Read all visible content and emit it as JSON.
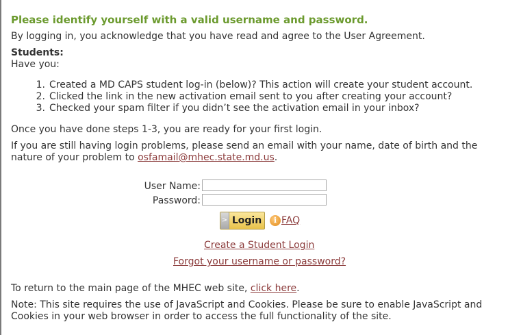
{
  "heading": "Please identify yourself with a valid username and password.",
  "intro": "By logging in, you acknowledge that you have read and agree to the User Agreement.",
  "students": {
    "label": "Students:",
    "have_you": "Have you:",
    "steps": [
      {
        "num": "1.",
        "text": "Created a MD CAPS student log-in (below)? This action will create your student account."
      },
      {
        "num": "2.",
        "text": "Clicked the link in the new activation email sent to you after creating your account?"
      },
      {
        "num": "3.",
        "text": "Checked your spam filter if you didn’t see the activation email in your inbox?"
      }
    ]
  },
  "once_done": "Once you have done steps 1-3, you are ready for your first login.",
  "problems": {
    "text_before": "If you are still having login problems, please send an email with your name, date of birth and the nature of your problem to ",
    "email": "osfamail@mhec.state.md.us",
    "text_after": "."
  },
  "form": {
    "username_label": "User Name:",
    "username_value": "",
    "password_label": "Password:",
    "password_value": "",
    "login_label": "Login",
    "login_arrow": ">",
    "info_icon": "i",
    "faq_label": "FAQ",
    "create_link": "Create a Student Login",
    "forgot_link": "Forgot your username or password?"
  },
  "return_line": {
    "text_before": "To return to the main page of the MHEC web site, ",
    "link": "click here",
    "text_after": "."
  },
  "note": "Note: This site requires the use of JavaScript and Cookies. Please be sure to enable JavaScript and Cookies in your web browser in order to access the full functionality of the site.",
  "colors": {
    "heading_green": "#6b9a2e",
    "link_red": "#8b3a3a",
    "login_gold": "#e8c24a"
  }
}
